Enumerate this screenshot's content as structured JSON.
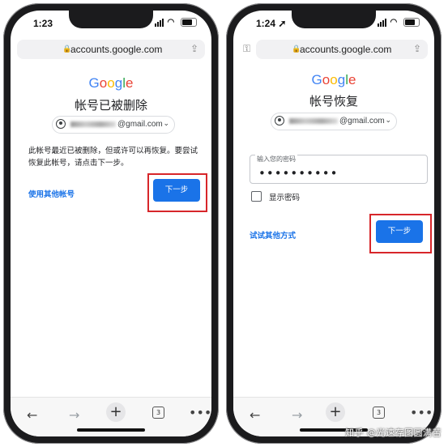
{
  "left_phone": {
    "status": {
      "time": "1:23"
    },
    "url": "accounts.google.com",
    "logo": [
      "G",
      "o",
      "o",
      "g",
      "l",
      "e"
    ],
    "heading": "帐号已被删除",
    "email_suffix": "@gmail.com",
    "message": "此帐号最近已被删除，但或许可以再恢复。要尝试恢复此帐号，请点击下一步。",
    "alt_link": "使用其他帐号",
    "next_button": "下一步",
    "tab_count": "3"
  },
  "right_phone": {
    "status": {
      "time": "1:24"
    },
    "url": "accounts.google.com",
    "logo": [
      "G",
      "o",
      "o",
      "g",
      "l",
      "e"
    ],
    "heading": "帐号恢复",
    "email_suffix": "@gmail.com",
    "password_label": "输入您的密码",
    "password_value": "••••••••••",
    "show_password": "显示密码",
    "alt_link": "试试其他方式",
    "next_button": "下一步",
    "tab_count": "3"
  },
  "watermark": "知乎 @光速存图圆满苦"
}
